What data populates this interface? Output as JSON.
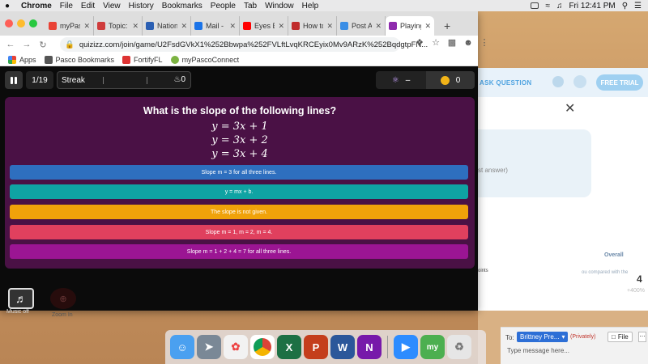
{
  "menubar": {
    "apple": "",
    "items": [
      "Chrome",
      "File",
      "Edit",
      "View",
      "History",
      "Bookmarks",
      "People",
      "Tab",
      "Window",
      "Help"
    ],
    "clock": "Fri 12:41 PM"
  },
  "browser": {
    "tabs": [
      {
        "title": "myPasc",
        "color": "#e94235",
        "active": false
      },
      {
        "title": "Topic: (",
        "color": "#cf3b3b",
        "active": false
      },
      {
        "title": "Nationa",
        "color": "#2b5fb3",
        "active": false
      },
      {
        "title": "Mail - (",
        "color": "#1a73e8",
        "active": false
      },
      {
        "title": "Eyes Bl",
        "color": "#ff0000",
        "active": false
      },
      {
        "title": "How to",
        "color": "#c02b2b",
        "active": false
      },
      {
        "title": "Post At",
        "color": "#3a8ee6",
        "active": false
      },
      {
        "title": "Playing",
        "color": "#8e2bad",
        "active": true
      }
    ],
    "url": "quizizz.com/join/game/U2FsdGVkX1%252Bbwpa%252FVLftLvqKRCEyix0Mv9ARzK%252BqdgtpFN...",
    "bookmarks": [
      "Apps",
      "Pasco Bookmarks",
      "FortifyFL",
      "myPascoConnect"
    ]
  },
  "game": {
    "counter": "1/19",
    "streak_label": "Streak",
    "streak_count": "0",
    "powerup_value": "–",
    "coins": "0",
    "question": "What is the slope of the following lines?",
    "equations": [
      "y = 3x + 1",
      "y = 3x + 2",
      "y = 3x + 4"
    ],
    "options": [
      {
        "text": "Slope m = 3 for all three lines.",
        "color": "#2e6fbf"
      },
      {
        "text": "y = mx + b.",
        "color": "#0fa3a3"
      },
      {
        "text": "The slope is not given.",
        "color": "#f0a20a"
      },
      {
        "text": "Slope m = 1, m = 2, m = 4.",
        "color": "#e0405e"
      },
      {
        "text": "Slope m = 1 + 2 + 4 = 7 for all three lines.",
        "color": "#9b1593"
      }
    ],
    "music_label": "Music off",
    "zoom_label": "Zoom In"
  },
  "background_page": {
    "ask": "ASK QUESTION",
    "free_btn": "FREE TRIAL",
    "hint": "st answer)",
    "points": "oints",
    "overall": "Overall",
    "compared": "ou compared with the",
    "number": "4",
    "percent": "+400%"
  },
  "chat": {
    "to_label": "To:",
    "recipient": "Brittney Pre...",
    "privacy": "(Privately)",
    "file_label": "File",
    "placeholder": "Type message here..."
  }
}
